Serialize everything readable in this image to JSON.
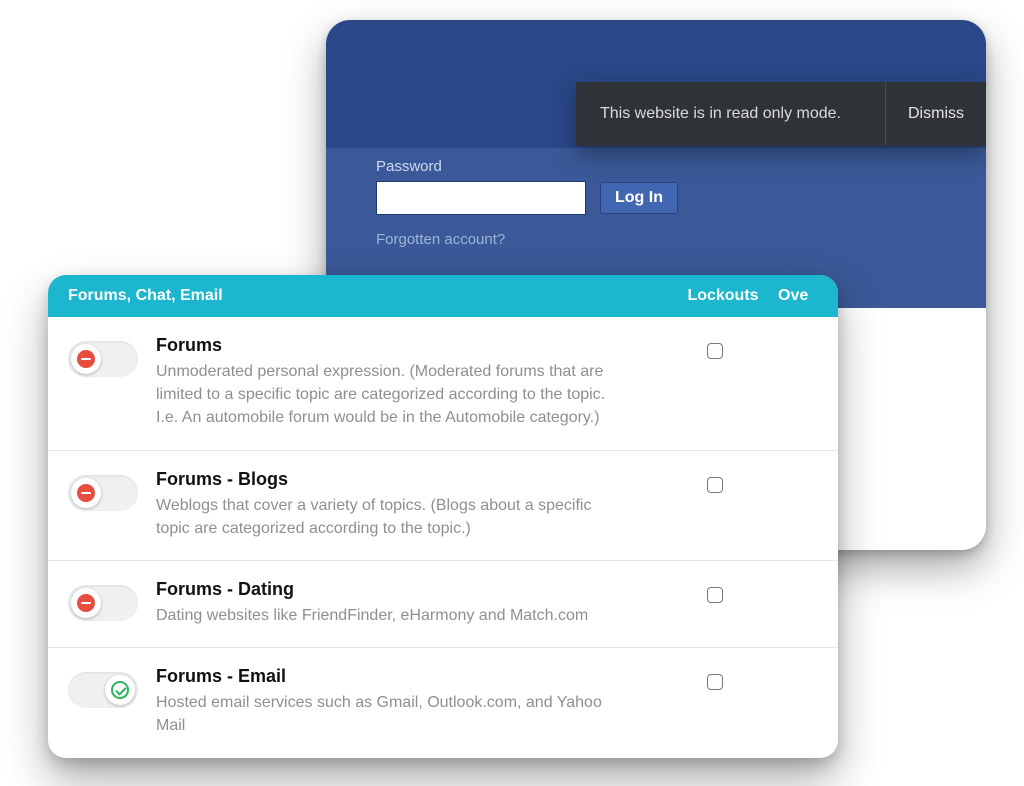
{
  "notification": {
    "message": "This website is in read only mode.",
    "dismiss": "Dismiss"
  },
  "login": {
    "password_label": "Password",
    "login_button": "Log In",
    "forgot_link": "Forgotten account?"
  },
  "panel": {
    "header_title": "Forums, Chat, Email",
    "header_lockouts": "Lockouts",
    "header_overflow": "Ove",
    "rows": [
      {
        "title": "Forums",
        "desc": "Unmoderated personal expression. (Moderated forums that are limited to a specific topic are categorized according to the topic. I.e. An automobile forum would be in the Automobile category.)",
        "state": "off"
      },
      {
        "title": "Forums - Blogs",
        "desc": "Weblogs that cover a variety of topics. (Blogs about a specific topic are categorized according to the topic.)",
        "state": "off"
      },
      {
        "title": "Forums - Dating",
        "desc": "Dating websites like FriendFinder, eHarmony and Match.com",
        "state": "off"
      },
      {
        "title": "Forums - Email",
        "desc": "Hosted email services such as Gmail, Outlook.com, and Yahoo Mail",
        "state": "on"
      }
    ]
  }
}
